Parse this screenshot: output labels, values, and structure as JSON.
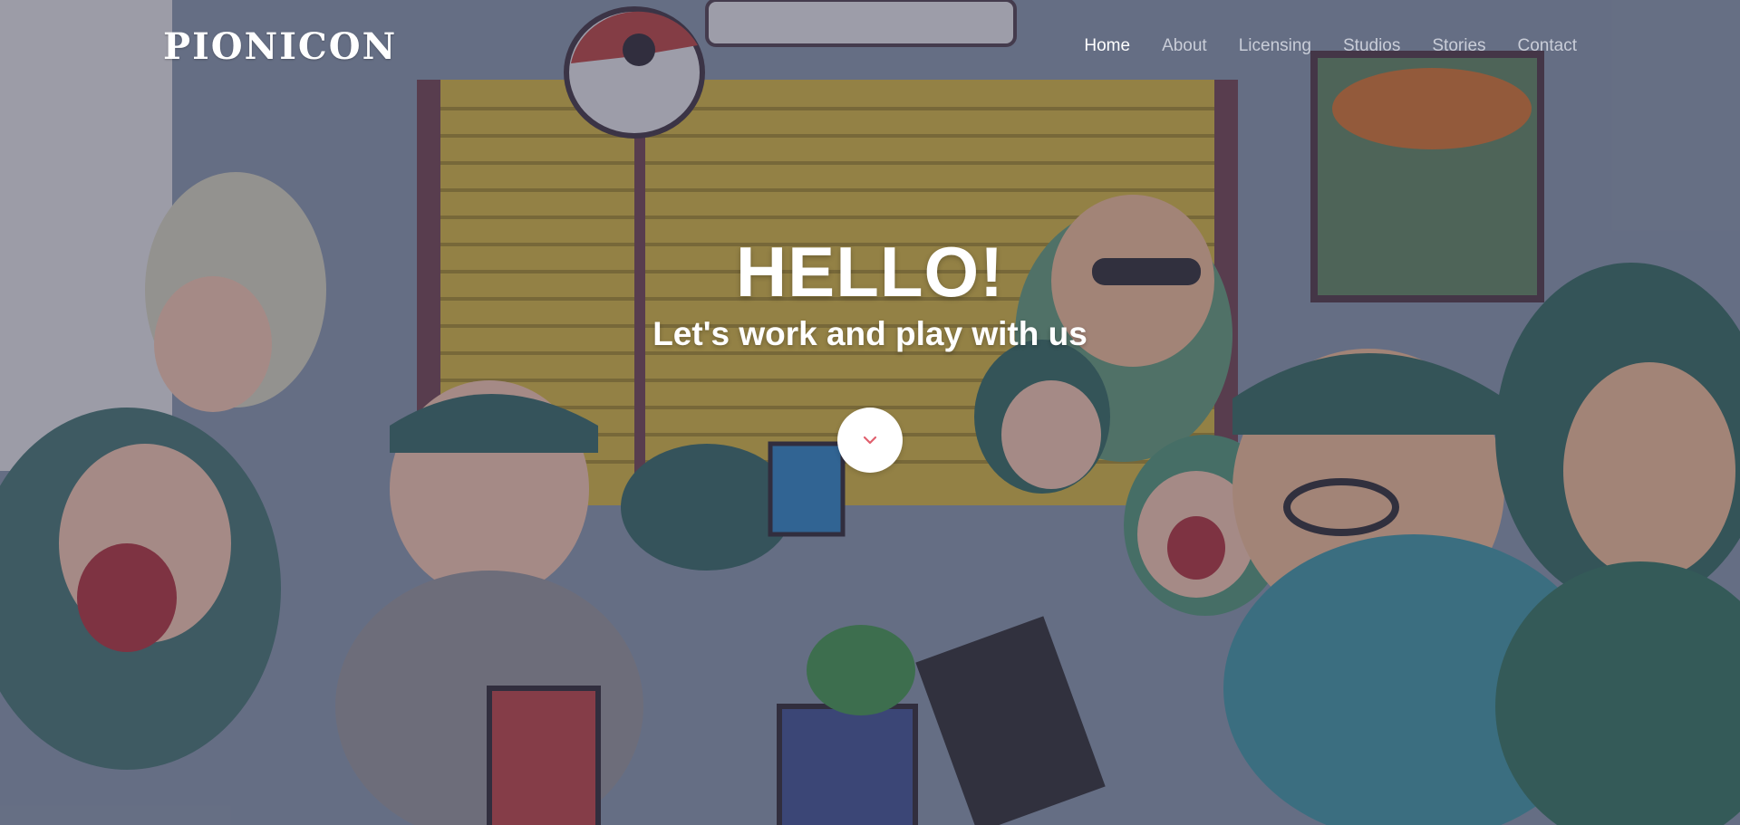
{
  "brand": {
    "logo_text": "PIONICON"
  },
  "nav": {
    "items": [
      {
        "label": "Home",
        "active": true
      },
      {
        "label": "About",
        "active": false
      },
      {
        "label": "Licensing",
        "active": false
      },
      {
        "label": "Studios",
        "active": false
      },
      {
        "label": "Stories",
        "active": false
      },
      {
        "label": "Contact",
        "active": false
      }
    ]
  },
  "hero": {
    "title": "HELLO!",
    "subtitle": "Let's work and play with us",
    "scroll_icon": "chevron-down-icon"
  },
  "colors": {
    "scroll_chevron": "#e0606e",
    "nav_active": "#ffffff",
    "nav_inactive": "#c9cdd8"
  }
}
